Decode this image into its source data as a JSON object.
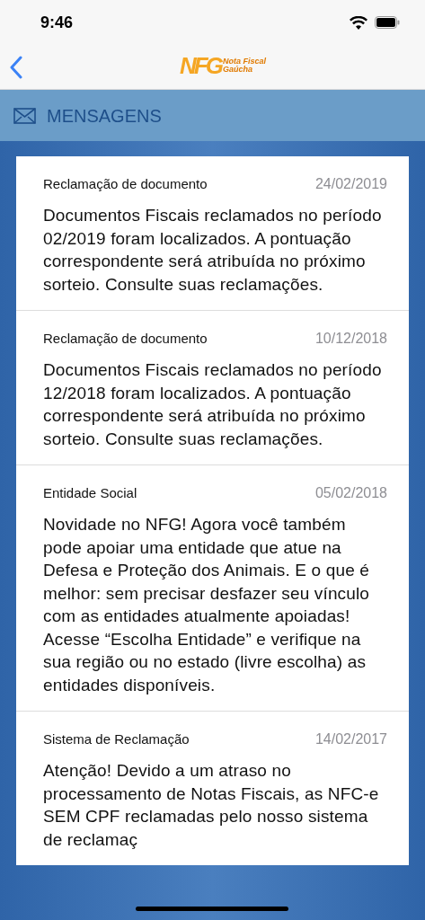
{
  "status_bar": {
    "time": "9:46"
  },
  "nav": {
    "logo_mark": "NFG",
    "logo_text": [
      "Nota Fiscal",
      "Gaúcha"
    ]
  },
  "header": {
    "title": "MENSAGENS"
  },
  "messages": [
    {
      "category": "Reclamação de documento",
      "date": "24/02/2019",
      "body": "Documentos Fiscais reclamados no período 02/2019 foram localizados. A pontuação correspondente será atribuída no próximo sorteio. Consulte suas reclamações."
    },
    {
      "category": "Reclamação de documento",
      "date": "10/12/2018",
      "body": "Documentos Fiscais reclamados no período 12/2018 foram localizados. A pontuação correspondente será atribuída no próximo sorteio. Consulte suas reclamações."
    },
    {
      "category": "Entidade Social",
      "date": "05/02/2018",
      "body": "Novidade no NFG! Agora você também pode apoiar uma entidade que atue na Defesa e Proteção dos Animais. E o que é melhor: sem precisar desfazer seu vínculo com as entidades atualmente apoiadas! Acesse “Escolha Entidade” e verifique na sua região ou no estado (livre escolha) as entidades disponíveis."
    },
    {
      "category": "Sistema de Reclamação",
      "date": "14/02/2017",
      "body": "Atenção! Devido a um atraso no processamento de Notas Fiscais, as NFC-e SEM CPF reclamadas pelo nosso sistema de reclamaç"
    }
  ]
}
